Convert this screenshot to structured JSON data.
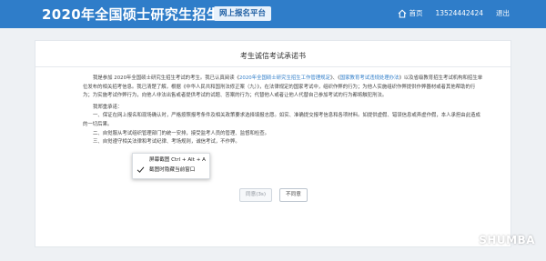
{
  "header": {
    "title": "2020年全国硕士研究生招生考试",
    "badge": "网上报名平台",
    "nav": {
      "home": "首页",
      "user": "13524442424",
      "logout": "退出"
    }
  },
  "pledge": {
    "title": "考生诚信考试承诺书",
    "para1_a": "我是参加 2020年全国硕士研究生招生考试的考生。我已认真阅读《",
    "link1": "2020年全国硕士研究生招生工作管理规定",
    "para1_b": "》、《",
    "link2": "国家教育考试违规处理办法",
    "para1_c": "》以及省级教育招生考试机构和招生单位发布的相关招考信息。我已清楚了解，根据《中华人民共和国刑法修正案（九）》，在法律规定的国家考试中，组织作弊的行为；为他人实施组织作弊提供作弊器材或者其他帮助的行为；为实施考试作弊行为，向他人非法出售或者提供考试的试题、答案的行为；代替他人或者让他人代替自己参加考试的行为都将触犯刑法。",
    "commit_heading": "我郑重承诺：",
    "item1": "一、保证在网上报名和现场确认时，严格按照报考条件及相关政策要求选择填报志愿。如实、准确提交报考信息和各项材料。如提供虚假、错误信息或弄虚作假，本人承担由此造成的一切后果。",
    "item2": "二、自觉服从考试组织管理部门的统一安排，接受监考人员的管理、监督和检查。",
    "item3": "三、自觉遵守相关法律和考试纪律、考场规则，诚信考试，不作弊。",
    "agree_button": "同意(3s)",
    "disagree_button": "不同意"
  },
  "context_menu": {
    "item1": "屏幕截图 Ctrl + Alt + A",
    "item2": "截图时隐藏当前窗口"
  },
  "watermark": {
    "text": "SHUMBA"
  },
  "colors": {
    "header": "#2f7dc9",
    "link": "#2f7dc9",
    "background": "#eef1f4"
  }
}
